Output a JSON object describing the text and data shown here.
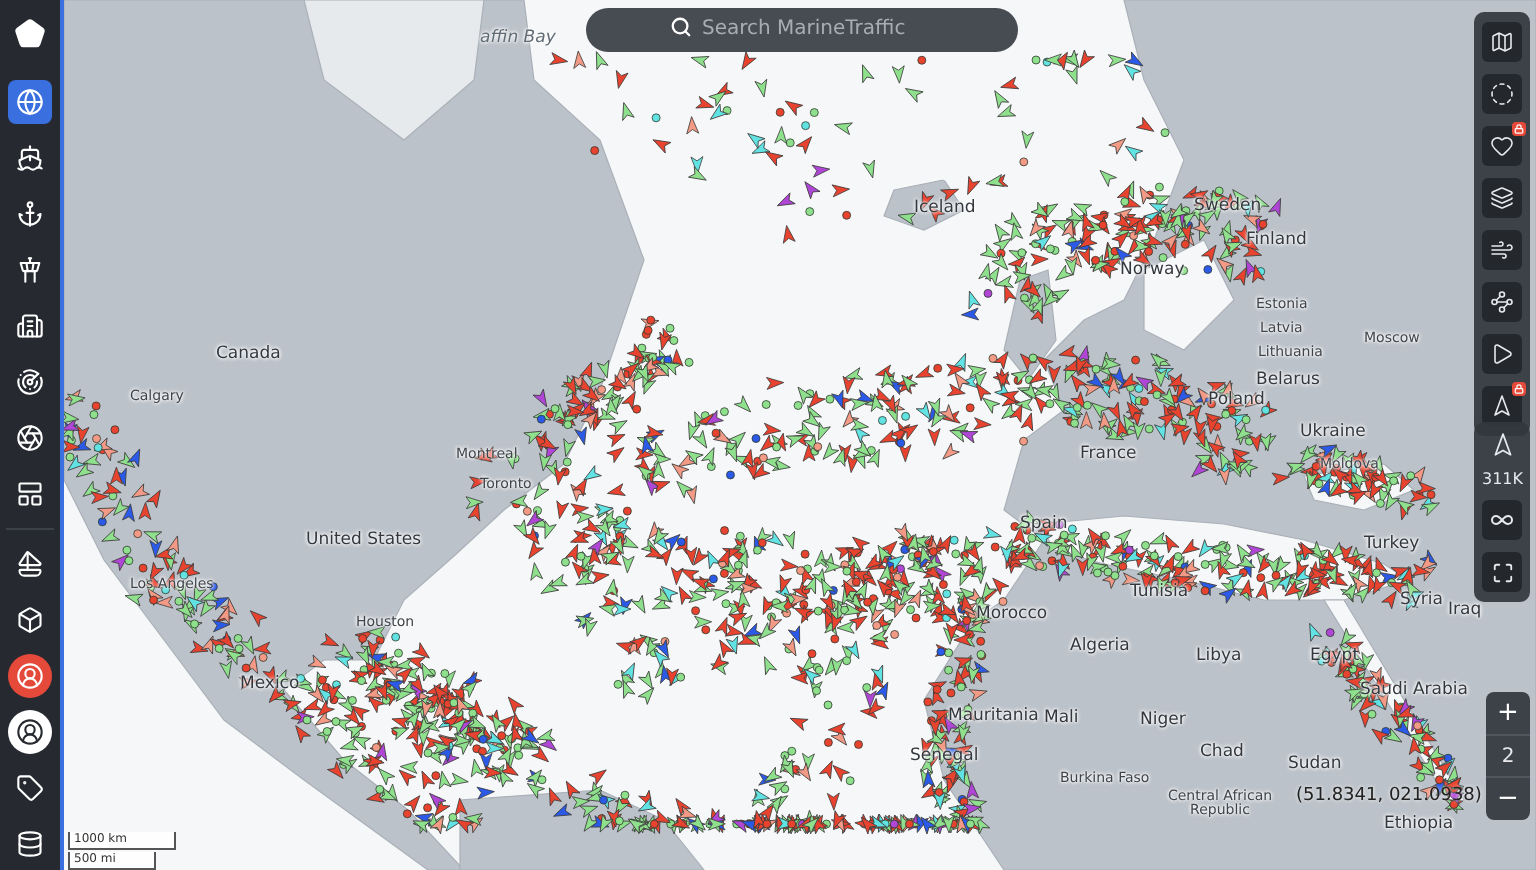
{
  "search": {
    "placeholder": "Search MarineTraffic"
  },
  "sidebar": {
    "items": [
      {
        "selected": true
      },
      {
        "selected": false
      },
      {
        "selected": false
      },
      {
        "selected": false
      },
      {
        "selected": false
      },
      {
        "selected": false
      },
      {
        "selected": false
      },
      {
        "selected": false
      },
      {
        "selected": false
      },
      {
        "selected": false
      },
      {
        "selected": false
      },
      {
        "selected": false
      },
      {
        "selected": false
      },
      {
        "selected": false
      }
    ]
  },
  "map": {
    "labels": [
      {
        "text": "affin Bay",
        "kind": "sea"
      },
      {
        "text": "Canada",
        "kind": "country"
      },
      {
        "text": "Calgary",
        "kind": "city"
      },
      {
        "text": "United States",
        "kind": "country"
      },
      {
        "text": "Los Angeles",
        "kind": "city"
      },
      {
        "text": "Houston",
        "kind": "city"
      },
      {
        "text": "Mexico",
        "kind": "country"
      },
      {
        "text": "Montreal",
        "kind": "city"
      },
      {
        "text": "Toronto",
        "kind": "city"
      },
      {
        "text": "Iceland",
        "kind": "country"
      },
      {
        "text": "Sweden",
        "kind": "country"
      },
      {
        "text": "Finland",
        "kind": "country"
      },
      {
        "text": "Norway",
        "kind": "country"
      },
      {
        "text": "Estonia",
        "kind": "city"
      },
      {
        "text": "Latvia",
        "kind": "city"
      },
      {
        "text": "Lithuania",
        "kind": "city"
      },
      {
        "text": "Belarus",
        "kind": "country"
      },
      {
        "text": "Poland",
        "kind": "country"
      },
      {
        "text": "France",
        "kind": "country"
      },
      {
        "text": "Ukraine",
        "kind": "country"
      },
      {
        "text": "Moldova",
        "kind": "city"
      },
      {
        "text": "Moscow",
        "kind": "city"
      },
      {
        "text": "Spain",
        "kind": "country"
      },
      {
        "text": "Turkey",
        "kind": "country"
      },
      {
        "text": "Syria",
        "kind": "country"
      },
      {
        "text": "Iraq",
        "kind": "country"
      },
      {
        "text": "Tunisia",
        "kind": "country"
      },
      {
        "text": "Morocco",
        "kind": "country"
      },
      {
        "text": "Algeria",
        "kind": "country"
      },
      {
        "text": "Libya",
        "kind": "country"
      },
      {
        "text": "Egypt",
        "kind": "country"
      },
      {
        "text": "Saudi Arabia",
        "kind": "country"
      },
      {
        "text": "Mauritania",
        "kind": "country"
      },
      {
        "text": "Mali",
        "kind": "country"
      },
      {
        "text": "Niger",
        "kind": "country"
      },
      {
        "text": "Chad",
        "kind": "country"
      },
      {
        "text": "Sudan",
        "kind": "country"
      },
      {
        "text": "Senegal",
        "kind": "country"
      },
      {
        "text": "Burkina Faso",
        "kind": "city"
      },
      {
        "text": "Central African Republic",
        "kind": "city"
      },
      {
        "text": "Ethiopia",
        "kind": "country"
      }
    ],
    "cursor_position": "(51.8341, 021.0938)"
  },
  "map_tools": {
    "items": [
      {
        "locked": false
      },
      {
        "locked": false
      },
      {
        "locked": true
      },
      {
        "locked": false
      },
      {
        "locked": false
      },
      {
        "locked": false
      },
      {
        "locked": false
      },
      {
        "locked": true
      }
    ]
  },
  "vessel_counter": {
    "count": "311K"
  },
  "zoom": {
    "in": "+",
    "level": "2",
    "out": "−"
  },
  "scale": {
    "metric": "1000 km",
    "imperial": "500 mi"
  }
}
